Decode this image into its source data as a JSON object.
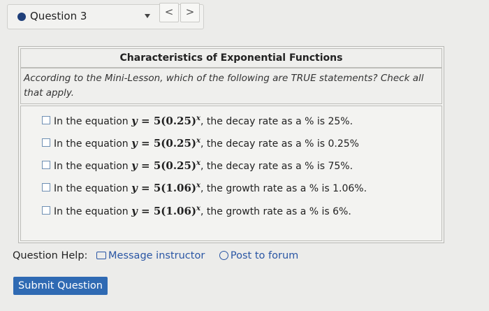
{
  "question_bar": {
    "label": "Question 3",
    "prev_label": "<",
    "next_label": ">"
  },
  "panel": {
    "title": "Characteristics of Exponential Functions",
    "prompt": "According to the Mini-Lesson, which of the following are TRUE statements? Check all that apply.",
    "choices": [
      {
        "prefix": "In the equation",
        "coef": "5",
        "base": "0.25",
        "suffix": ", the decay rate as a % is 25%."
      },
      {
        "prefix": "In the equation",
        "coef": "5",
        "base": "0.25",
        "suffix": ", the decay rate as a % is 0.25%"
      },
      {
        "prefix": "In the equation",
        "coef": "5",
        "base": "0.25",
        "suffix": ", the decay rate as a % is 75%."
      },
      {
        "prefix": "In the equation",
        "coef": "5",
        "base": "1.06",
        "suffix": ", the growth rate as a % is 1.06%."
      },
      {
        "prefix": "In the equation",
        "coef": "5",
        "base": "1.06",
        "suffix": ", the growth rate as a % is 6%."
      }
    ]
  },
  "help": {
    "label": "Question Help:",
    "message_link": "Message instructor",
    "forum_link": "Post to forum"
  },
  "submit_label": "Submit Question",
  "colors": {
    "accent": "#2f6ab3",
    "link": "#2a56a4",
    "dot": "#1f3f7a"
  }
}
